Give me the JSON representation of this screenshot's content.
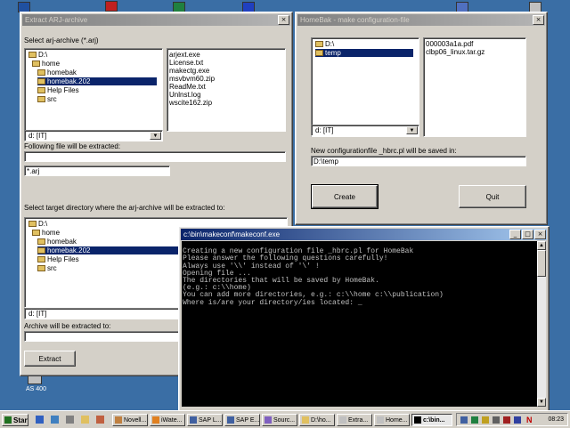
{
  "desktop": {
    "icon_label": "AS 400"
  },
  "extract_window": {
    "title": "Extract ARJ-archive",
    "select_label": "Select arj-archive (*.arj)",
    "tree": [
      "D:\\",
      "home",
      "homebak",
      "homebak.202",
      "Help Files",
      "src"
    ],
    "files": [
      "arjext.exe",
      "License.txt",
      "makectg.exe",
      "msvbvm60.zip",
      "ReadMe.txt",
      "Unlnst.log",
      "wscite162.zip"
    ],
    "drive": "d: [IT]",
    "following_label": "Following file will be extracted:",
    "following_value": "",
    "filter_value": "*.arj",
    "target_label": "Select target directory where the arj-archive will be extracted to:",
    "target_tree": [
      "D:\\",
      "home",
      "homebak",
      "homebak.202",
      "Help Files",
      "src"
    ],
    "target_drive": "d: [IT]",
    "extract_to_label": "Archive will be extracted to:",
    "extract_button": "Extract"
  },
  "homebak_window": {
    "title": "HomeBak - make configuration-file",
    "tree": [
      "D:\\",
      "temp"
    ],
    "files": [
      "000003a1a.pdf",
      "clbp06_linux.tar.gz"
    ],
    "drive": "d: [IT]",
    "save_label": "New configurationfile _hbrc.pl will be saved in:",
    "save_value": "D:\\temp",
    "create_button": "Create",
    "quit_button": "Quit"
  },
  "console_window": {
    "title": "c:\\bin\\makeconf\\makeconf.exe",
    "lines": [
      "Creating a new configuration file _hbrc.pl for HomeBak",
      "Please answer the following questions carefully!",
      "Always use '\\\\' instead of '\\' !",
      "",
      "Opening file ...",
      "",
      "The directories that will be saved by HomeBak.",
      "(e.g.: c:\\\\home)",
      "You can add more directories, e.g.: c:\\\\home c:\\\\publication)",
      "Where is/are your directory/ies located: _"
    ]
  },
  "taskbar": {
    "start": "Start",
    "tasks": [
      "Novell...",
      "iWate...",
      "SAP L...",
      "SAP E...",
      "Sourc...",
      "D:\\ho...",
      "Extra...",
      "Home...",
      "c:\\bin..."
    ],
    "clock": "08:23"
  },
  "colors": {
    "desktop": "#3a6ea5",
    "titlebar_active": "#0a246a",
    "titlebar_inactive": "#808080",
    "selection": "#0a246a"
  }
}
